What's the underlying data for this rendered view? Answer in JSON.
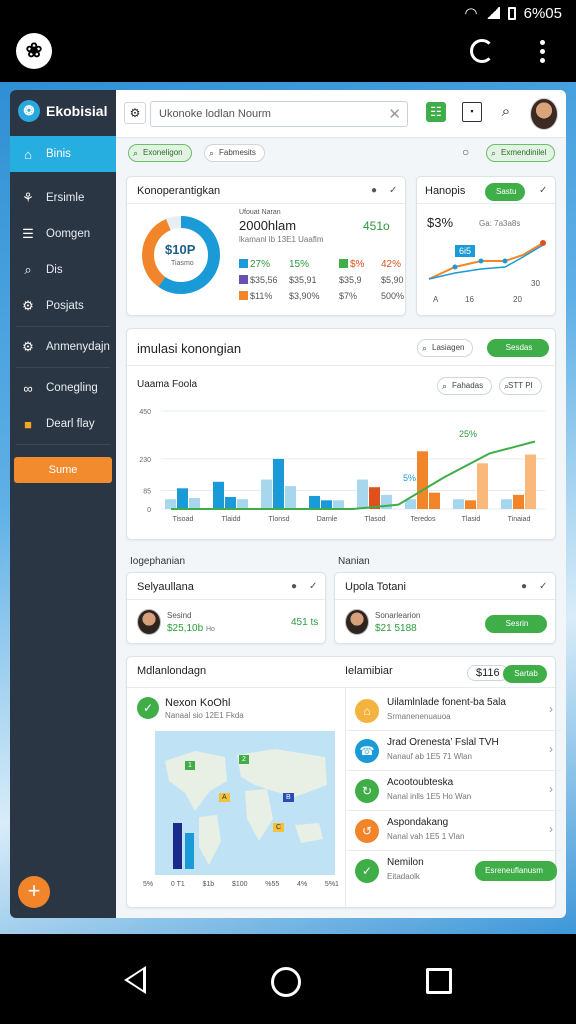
{
  "status_bar": {
    "clock": "6%05"
  },
  "sidebar": {
    "brand": "Ekobisial",
    "items": [
      {
        "label": "Binis",
        "icon": "home-icon"
      },
      {
        "label": "Ersimle",
        "icon": "tools-icon"
      },
      {
        "label": "Oomgen",
        "icon": "document-icon"
      },
      {
        "label": "Dis",
        "icon": "search-icon"
      },
      {
        "label": "Posjats",
        "icon": "gear-icon"
      },
      {
        "label": "Anmenydajn",
        "icon": "settings-icon"
      },
      {
        "label": "Conegling",
        "icon": "link-icon"
      },
      {
        "label": "Dearl flay",
        "icon": "folder-icon"
      }
    ],
    "sum_button": "Sume"
  },
  "topbar": {
    "search_value": "Ukonoke lodlan Nourm"
  },
  "filters": {
    "left_pill": "Exoneligon",
    "right_pill": "Fabmesits",
    "green_pill": "Exmendinilel"
  },
  "card_kpi": {
    "title": "Konoperantigkan",
    "donut_value": "$10P",
    "donut_sub": "Tiasmo",
    "line1": "Ufouat Naran",
    "headline": "2000hlam",
    "headline_value": "451o",
    "sub": "lkamanl lb 13E1 Uaaflm",
    "row1": [
      "27%",
      "15%",
      "$%",
      "42%"
    ],
    "row2": [
      "$35,56",
      "$35,91",
      "$35,9",
      "$5,90"
    ],
    "row3": [
      "$11%",
      "$3,90%",
      "$7%",
      "500%"
    ]
  },
  "card_hanopis": {
    "title": "Hanopis",
    "button": "Sastu",
    "value": "$3%",
    "value2": "Ga: 7a3a8s",
    "badge": "6i5",
    "xlabels": [
      "A",
      "16",
      "20"
    ],
    "yright": "30"
  },
  "card_bar": {
    "title": "imulasi konongian",
    "btn_outline": "Lasiagen",
    "btn_green": "Sesdas",
    "subtitle": "Uaama Foola",
    "chip1": "Fahadas",
    "chip2": "STT PI",
    "annot1": "25%",
    "annot2": "5%"
  },
  "chart_data": {
    "type": "bar",
    "categories": [
      "Tisoad",
      "Tlaidd",
      "Tlonsd",
      "Darnle",
      "Tlasod",
      "Teredos",
      "Tlasid",
      "Tinaiad"
    ],
    "ylim": [
      0,
      450
    ],
    "yticks": [
      0,
      85,
      230,
      450
    ],
    "series": [
      {
        "name": "",
        "values": [
          45,
          125,
          135,
          60,
          135,
          45,
          45,
          45
        ]
      },
      {
        "name": "",
        "values": [
          95,
          55,
          230,
          40,
          100,
          265,
          40,
          65
        ]
      },
      {
        "name": "",
        "values": [
          50,
          45,
          105,
          40,
          65,
          75,
          210,
          250
        ]
      },
      {
        "name": "",
        "values": [
          0,
          0,
          0,
          0,
          0,
          0,
          0,
          0
        ]
      }
    ],
    "trend": [
      0,
      0,
      0,
      0,
      0,
      20,
      145,
      255,
      310
    ]
  },
  "row_labels": {
    "left": "Iogephanian",
    "right": "Nanian"
  },
  "card_person_left": {
    "title": "Selyaullana",
    "name": "Sesind",
    "value": "$25,10b",
    "unit": "Ho",
    "score": "451 ts"
  },
  "card_person_right": {
    "title": "Upola Totani",
    "name": "Sonarlearion",
    "value": "$21 5188",
    "button": "Sesrin"
  },
  "section_bottom": {
    "left_title": "Mdlanlondagn",
    "right_title": "Ielamibiar",
    "right_value": "$116",
    "right_btn": "Sartab"
  },
  "map_card": {
    "title": "Nexon KoOhl",
    "sub": "Nanaal sio 12E1 Fkda",
    "map_labels": [
      "1",
      "2",
      "A",
      "B",
      "C"
    ],
    "xlabels": [
      "5%",
      "0 T1",
      "$1b",
      "$100",
      "%55",
      "4%",
      "5%1"
    ]
  },
  "list": [
    {
      "title": "Uilamlnlade fonent-ba 5ala",
      "sub": "Srmanenenuauoa",
      "icon": "bank-icon",
      "color": "#f4b33e"
    },
    {
      "title": "Jrad Orenesta’ Fslal TVH",
      "sub": "Nanauf ab 1E5 71 Wlan",
      "icon": "phone-icon",
      "color": "#1a9bd7"
    },
    {
      "title": "Acootoubteska",
      "sub": "Nanal inlls 1E5 Ho Wan",
      "icon": "refresh-icon",
      "color": "#3fae49"
    },
    {
      "title": "Aspondakang",
      "sub": "Nanal vah 1E5 1 Vlan",
      "icon": "sync-icon",
      "color": "#f2842a"
    },
    {
      "title": "Nemilon",
      "sub": "Eitadaolk",
      "icon": "check-icon",
      "color": "#3fae49",
      "button": "Esreneuflanusm"
    }
  ]
}
